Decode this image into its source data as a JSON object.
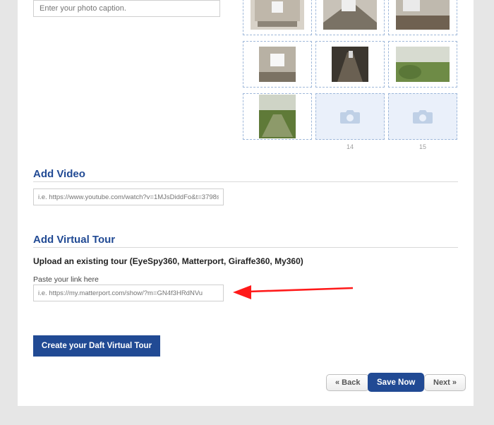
{
  "caption": {
    "placeholder": "Enter your photo caption."
  },
  "thumbs": {
    "num14": "14",
    "num15": "15"
  },
  "video": {
    "heading": "Add Video",
    "placeholder": "i.e. https://www.youtube.com/watch?v=1MJsDiddFo&t=3798s"
  },
  "tour": {
    "heading": "Add Virtual Tour",
    "subheading": "Upload an existing tour (EyeSpy360, Matterport, Giraffe360, My360)",
    "paste_label": "Paste your link here",
    "placeholder": "i.e. https://my.matterport.com/show/?m=GN4f3HRdNVu",
    "create_label": "Create your Daft Virtual Tour"
  },
  "nav": {
    "back": "« Back",
    "save": "Save Now",
    "next": "Next »"
  }
}
